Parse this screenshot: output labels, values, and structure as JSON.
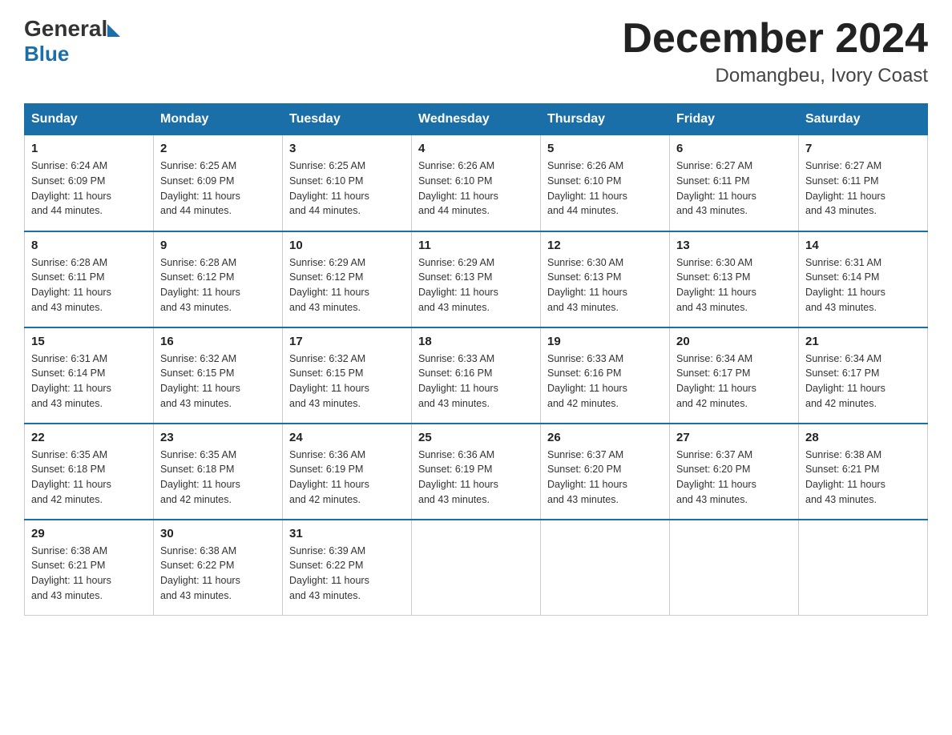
{
  "logo": {
    "general": "General",
    "blue": "Blue"
  },
  "title": {
    "month": "December 2024",
    "location": "Domangbeu, Ivory Coast"
  },
  "days_of_week": [
    "Sunday",
    "Monday",
    "Tuesday",
    "Wednesday",
    "Thursday",
    "Friday",
    "Saturday"
  ],
  "weeks": [
    [
      {
        "num": "1",
        "sunrise": "6:24 AM",
        "sunset": "6:09 PM",
        "daylight": "11 hours and 44 minutes."
      },
      {
        "num": "2",
        "sunrise": "6:25 AM",
        "sunset": "6:09 PM",
        "daylight": "11 hours and 44 minutes."
      },
      {
        "num": "3",
        "sunrise": "6:25 AM",
        "sunset": "6:10 PM",
        "daylight": "11 hours and 44 minutes."
      },
      {
        "num": "4",
        "sunrise": "6:26 AM",
        "sunset": "6:10 PM",
        "daylight": "11 hours and 44 minutes."
      },
      {
        "num": "5",
        "sunrise": "6:26 AM",
        "sunset": "6:10 PM",
        "daylight": "11 hours and 44 minutes."
      },
      {
        "num": "6",
        "sunrise": "6:27 AM",
        "sunset": "6:11 PM",
        "daylight": "11 hours and 43 minutes."
      },
      {
        "num": "7",
        "sunrise": "6:27 AM",
        "sunset": "6:11 PM",
        "daylight": "11 hours and 43 minutes."
      }
    ],
    [
      {
        "num": "8",
        "sunrise": "6:28 AM",
        "sunset": "6:11 PM",
        "daylight": "11 hours and 43 minutes."
      },
      {
        "num": "9",
        "sunrise": "6:28 AM",
        "sunset": "6:12 PM",
        "daylight": "11 hours and 43 minutes."
      },
      {
        "num": "10",
        "sunrise": "6:29 AM",
        "sunset": "6:12 PM",
        "daylight": "11 hours and 43 minutes."
      },
      {
        "num": "11",
        "sunrise": "6:29 AM",
        "sunset": "6:13 PM",
        "daylight": "11 hours and 43 minutes."
      },
      {
        "num": "12",
        "sunrise": "6:30 AM",
        "sunset": "6:13 PM",
        "daylight": "11 hours and 43 minutes."
      },
      {
        "num": "13",
        "sunrise": "6:30 AM",
        "sunset": "6:13 PM",
        "daylight": "11 hours and 43 minutes."
      },
      {
        "num": "14",
        "sunrise": "6:31 AM",
        "sunset": "6:14 PM",
        "daylight": "11 hours and 43 minutes."
      }
    ],
    [
      {
        "num": "15",
        "sunrise": "6:31 AM",
        "sunset": "6:14 PM",
        "daylight": "11 hours and 43 minutes."
      },
      {
        "num": "16",
        "sunrise": "6:32 AM",
        "sunset": "6:15 PM",
        "daylight": "11 hours and 43 minutes."
      },
      {
        "num": "17",
        "sunrise": "6:32 AM",
        "sunset": "6:15 PM",
        "daylight": "11 hours and 43 minutes."
      },
      {
        "num": "18",
        "sunrise": "6:33 AM",
        "sunset": "6:16 PM",
        "daylight": "11 hours and 43 minutes."
      },
      {
        "num": "19",
        "sunrise": "6:33 AM",
        "sunset": "6:16 PM",
        "daylight": "11 hours and 42 minutes."
      },
      {
        "num": "20",
        "sunrise": "6:34 AM",
        "sunset": "6:17 PM",
        "daylight": "11 hours and 42 minutes."
      },
      {
        "num": "21",
        "sunrise": "6:34 AM",
        "sunset": "6:17 PM",
        "daylight": "11 hours and 42 minutes."
      }
    ],
    [
      {
        "num": "22",
        "sunrise": "6:35 AM",
        "sunset": "6:18 PM",
        "daylight": "11 hours and 42 minutes."
      },
      {
        "num": "23",
        "sunrise": "6:35 AM",
        "sunset": "6:18 PM",
        "daylight": "11 hours and 42 minutes."
      },
      {
        "num": "24",
        "sunrise": "6:36 AM",
        "sunset": "6:19 PM",
        "daylight": "11 hours and 42 minutes."
      },
      {
        "num": "25",
        "sunrise": "6:36 AM",
        "sunset": "6:19 PM",
        "daylight": "11 hours and 43 minutes."
      },
      {
        "num": "26",
        "sunrise": "6:37 AM",
        "sunset": "6:20 PM",
        "daylight": "11 hours and 43 minutes."
      },
      {
        "num": "27",
        "sunrise": "6:37 AM",
        "sunset": "6:20 PM",
        "daylight": "11 hours and 43 minutes."
      },
      {
        "num": "28",
        "sunrise": "6:38 AM",
        "sunset": "6:21 PM",
        "daylight": "11 hours and 43 minutes."
      }
    ],
    [
      {
        "num": "29",
        "sunrise": "6:38 AM",
        "sunset": "6:21 PM",
        "daylight": "11 hours and 43 minutes."
      },
      {
        "num": "30",
        "sunrise": "6:38 AM",
        "sunset": "6:22 PM",
        "daylight": "11 hours and 43 minutes."
      },
      {
        "num": "31",
        "sunrise": "6:39 AM",
        "sunset": "6:22 PM",
        "daylight": "11 hours and 43 minutes."
      },
      null,
      null,
      null,
      null
    ]
  ],
  "labels": {
    "sunrise": "Sunrise:",
    "sunset": "Sunset:",
    "daylight": "Daylight:"
  }
}
